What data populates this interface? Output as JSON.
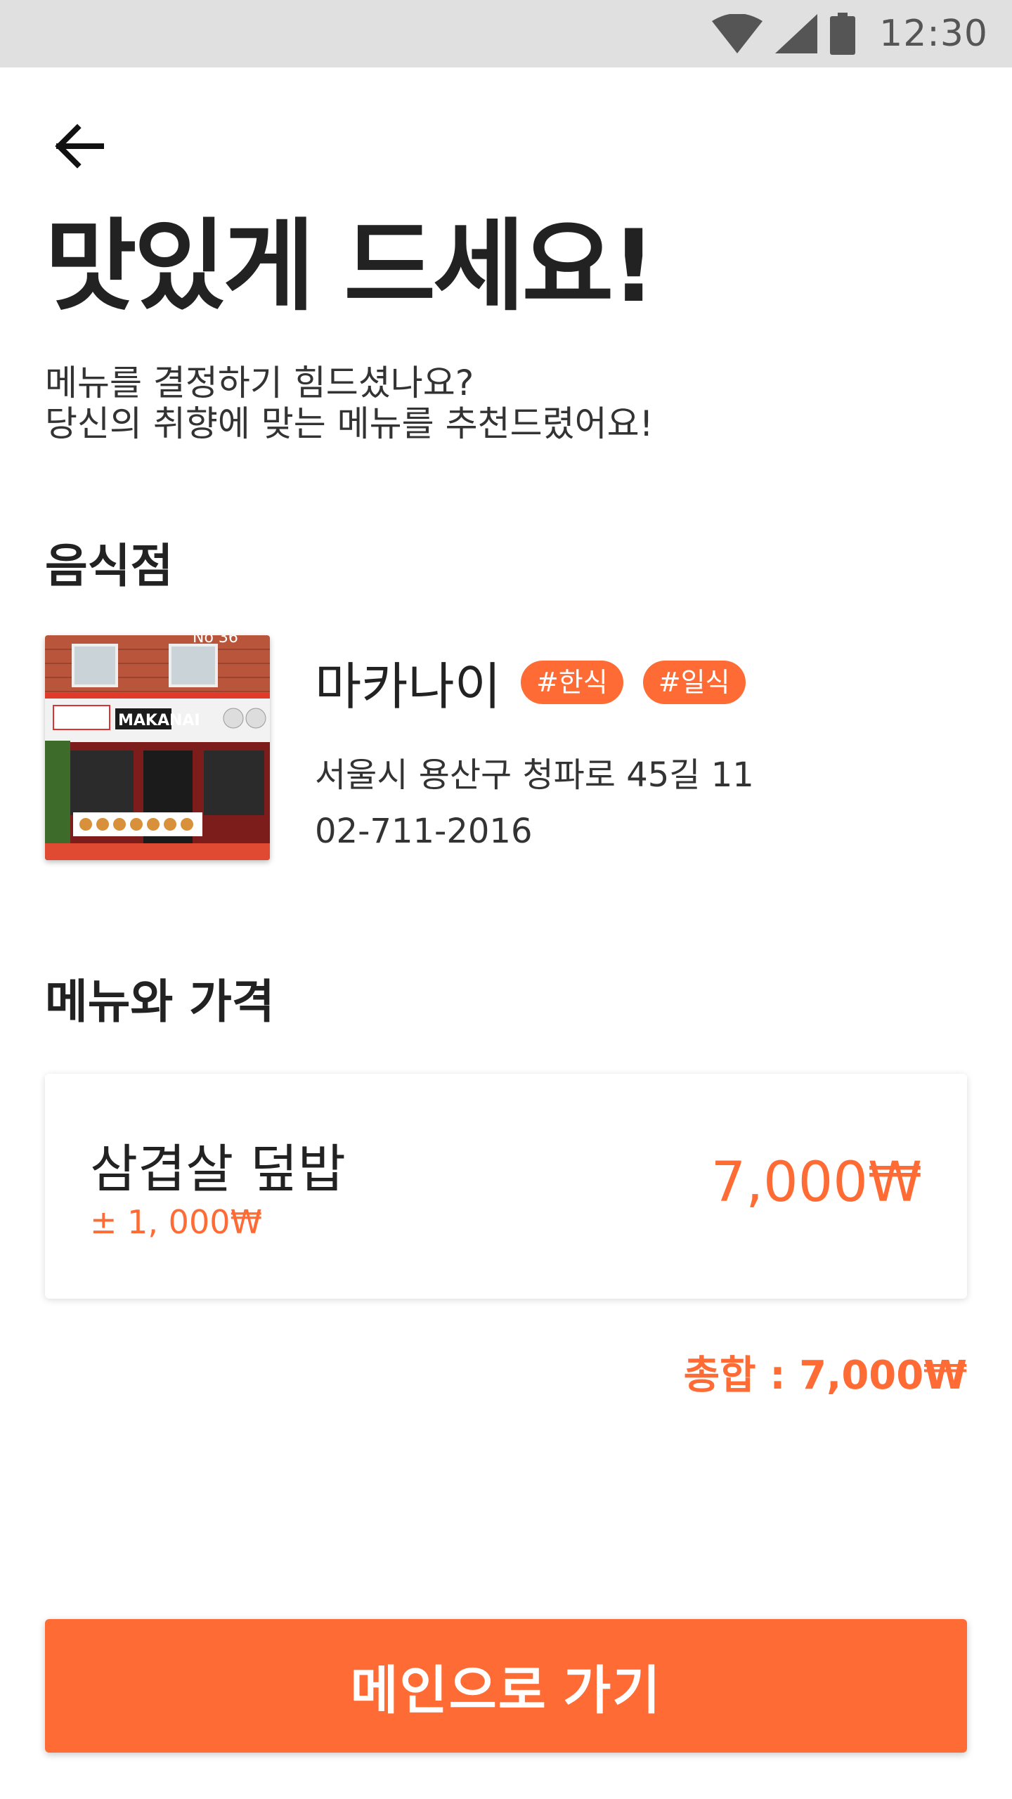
{
  "status_bar": {
    "time": "12:30"
  },
  "header": {
    "back_icon": "arrow-left-icon"
  },
  "title": "맛있게 드세요!",
  "subtitle": {
    "line1": "메뉴를 결정하기 힘드셨나요?",
    "line2": "당신의 취향에 맞는 메뉴를 추천드렸어요!"
  },
  "restaurant": {
    "heading": "음식점",
    "name": "마카나이",
    "tags": [
      "#한식",
      "#일식"
    ],
    "address": "서울시 용산구 청파로 45길 11",
    "phone": "02-711-2016",
    "sign_text": "MAKANAI",
    "building_number": "No 36"
  },
  "menu": {
    "heading": "메뉴와 가격",
    "items": [
      {
        "name": "삼겹살 덮밥",
        "range": "± 1, 000₩",
        "price": "7,000₩"
      }
    ],
    "total": "총합 : 7,000₩"
  },
  "main_button_label": "메인으로 가기",
  "colors": {
    "accent": "#ff6b35",
    "status_bar": "#e0e0e0",
    "text": "#222222"
  }
}
